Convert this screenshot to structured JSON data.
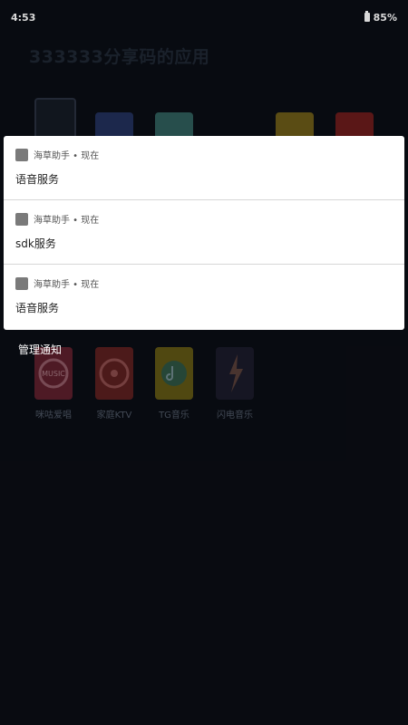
{
  "status_bar": {
    "time": "4:53",
    "battery": "85%"
  },
  "background": {
    "title": "333333分享码的应用",
    "apps_row2": [
      {
        "label": "咪咕爱唱",
        "icon": "music-mic-icon"
      },
      {
        "label": "家庭KTV",
        "icon": "ktv-reel-icon"
      },
      {
        "label": "TG音乐",
        "icon": "music-note-icon"
      },
      {
        "label": "闪电音乐",
        "icon": "lightning-icon"
      }
    ]
  },
  "notifications": [
    {
      "app": "海草助手 • 现在",
      "text": "语音服务"
    },
    {
      "app": "海草助手 • 现在",
      "text": "sdk服务"
    },
    {
      "app": "海草助手 • 现在",
      "text": "语音服务"
    }
  ],
  "manage_label": "管理通知",
  "colors": {
    "background": "#0a0d14",
    "panel": "#ffffff",
    "app_square": "#7a7a7a"
  }
}
